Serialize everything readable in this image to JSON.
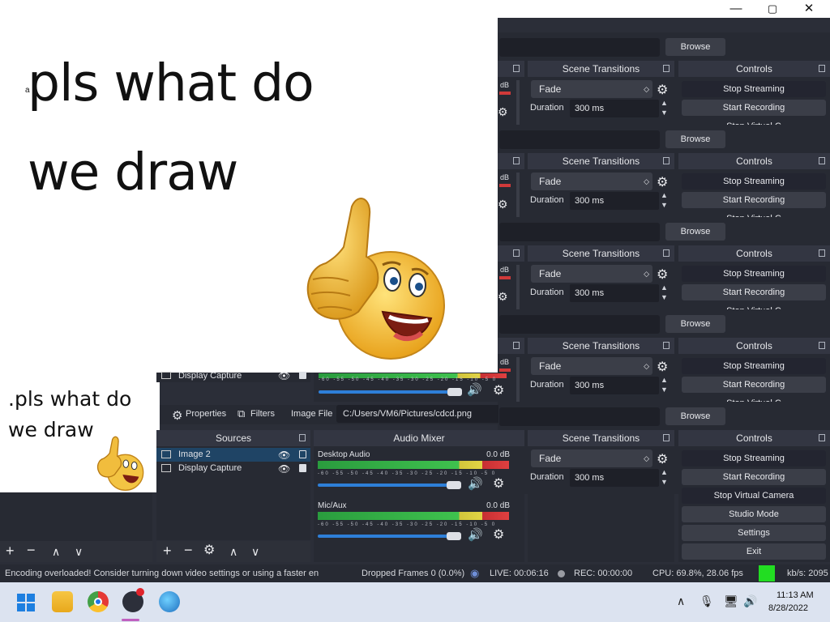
{
  "window": {
    "minimize": "—",
    "maximize": "▢",
    "close": "✕"
  },
  "preview": {
    "tiny_text": "a",
    "line1": "pls what do",
    "line2": "we draw"
  },
  "thumbnail": {
    "line1": ".pls what do",
    "line2": "we draw"
  },
  "browse_label": "Browse",
  "transitions": {
    "title": "Scene Transitions",
    "selected": "Fade",
    "duration_label": "Duration",
    "duration_value": "300 ms"
  },
  "controls": {
    "title": "Controls",
    "stop_streaming": "Stop Streaming",
    "start_recording": "Start Recording",
    "stop_virtual_camera": "Stop Virtual Camera",
    "studio_mode": "Studio Mode",
    "settings": "Settings",
    "exit": "Exit",
    "partial": "Stop Virtual C"
  },
  "meter_db_partial": "dB",
  "sources": {
    "title": "Sources",
    "items": [
      {
        "label": "Image 2"
      },
      {
        "label": "Display Capture"
      }
    ],
    "stray_label": "Display Capture"
  },
  "toolbar": {
    "properties": "Properties",
    "filters": "Filters",
    "image_file_label": "Image File",
    "image_file_path": "C:/Users/VM6/Pictures/cdcd.png"
  },
  "mixer": {
    "title": "Audio Mixer",
    "channels": [
      {
        "name": "Desktop Audio",
        "db": "0.0 dB"
      },
      {
        "name": "Mic/Aux",
        "db": "0.0 dB"
      }
    ],
    "scale": "-60 -55 -50 -45 -40 -35 -30 -25 -20 -15 -10 -5 0"
  },
  "status": {
    "message": "Encoding overloaded! Consider turning down video settings or using a faster en",
    "dropped": "Dropped Frames 0 (0.0%)",
    "live": "LIVE: 00:06:16",
    "rec": "REC: 00:00:00",
    "cpu": "CPU: 69.8%, 28.06 fps",
    "kbs": "kb/s: 2095"
  },
  "taskbar": {
    "time": "11:13 AM",
    "date": "8/28/2022"
  },
  "colors": {
    "accent": "#2e7fd8",
    "status_ok": "#22dd22",
    "record_dot": "#e0242c"
  }
}
